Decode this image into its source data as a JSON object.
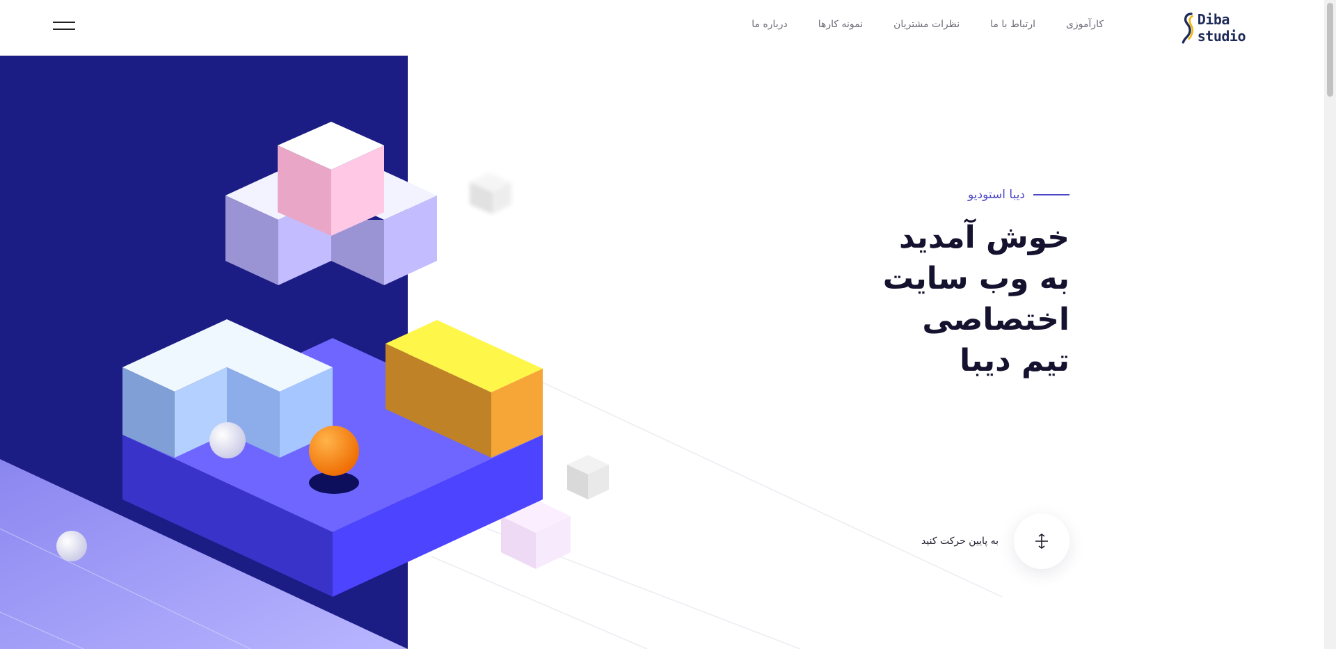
{
  "header": {
    "logo_text": "Diba studio",
    "nav": [
      {
        "label": "درباره ما"
      },
      {
        "label": "نمونه کارها"
      },
      {
        "label": "نظرات مشتریان"
      },
      {
        "label": "ارتباط با ما"
      },
      {
        "label": "کارآموزی"
      }
    ],
    "menu_icon": "hamburger-icon"
  },
  "hero": {
    "eyebrow": "دیبا استودیو",
    "title_lines": [
      "خوش آمدید",
      "به وب سایت",
      "اختصاصی",
      "تیم دیبا"
    ],
    "scroll_label": "به پایین حرکت کنید",
    "scroll_icon": "scroll-down-icon"
  },
  "colors": {
    "accent": "#4b46c8",
    "navy": "#1c1c85",
    "heading": "#14122e"
  }
}
